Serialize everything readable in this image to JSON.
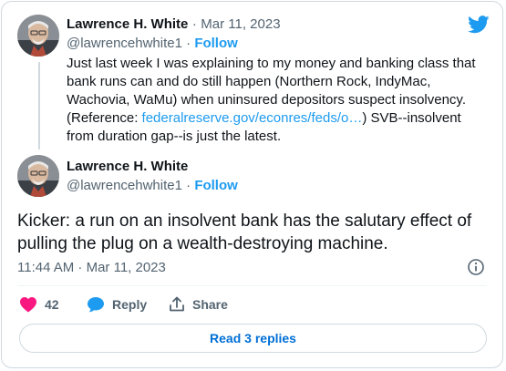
{
  "quoted_tweet": {
    "author_name": "Lawrence H. White",
    "separator": "·",
    "date": "Mar 11, 2023",
    "handle": "@lawrencehwhite1",
    "follow_label": "Follow",
    "text_before_link": "Just last week I was explaining to my money and banking class that bank runs can and do still happen (Northern Rock, IndyMac, Wachovia, WaMu) when uninsured depositors suspect insolvency. (Reference: ",
    "link_text": "federalreserve.gov/econres/feds/o…",
    "text_after_link": ") SVB--insolvent from duration gap--is just the latest."
  },
  "main_tweet": {
    "author_name": "Lawrence H. White",
    "handle": "@lawrencehwhite1",
    "follow_label": "Follow",
    "text": "Kicker: a run on an insolvent bank has the salutary effect of pulling the plug on a wealth-destroying machine.",
    "timestamp": "11:44 AM · Mar 11, 2023"
  },
  "actions": {
    "like_count": "42",
    "reply_label": "Reply",
    "share_label": "Share"
  },
  "read_replies_label": "Read 3 replies",
  "icons": {
    "brand": "twitter-bird-icon",
    "info": "info-icon",
    "like": "heart-icon",
    "reply": "reply-bubble-icon",
    "share": "share-icon"
  },
  "colors": {
    "accent": "#1d9bf0",
    "like": "#f91880",
    "text": "#0f1419",
    "muted": "#536471",
    "border": "#cfd9de"
  }
}
